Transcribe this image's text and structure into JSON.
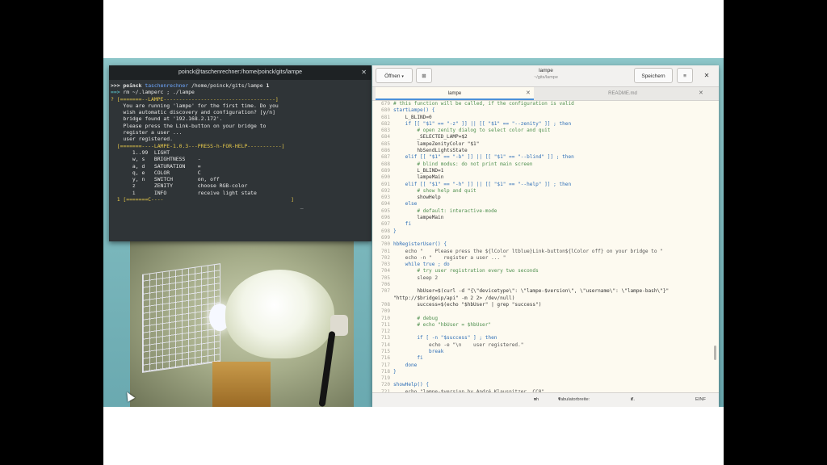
{
  "terminal": {
    "title": "poinck@taschenrechner:/home/poinck/gits/lampe",
    "prompt_user": "poinck",
    "prompt_host": "taschenrechner",
    "prompt_path": "/home/poinck/gits/lampe",
    "prompt_num": "1",
    "cmd": "rm ~/.lamperc ; ./lampe",
    "lines": [
      "? [=======--LAMPE------------------------------------]",
      "    You are running 'lampe' for the first time. Do you",
      "    wish automatic discovery and configuration? [y/n]",
      "    bridge found at '192.168.2.172'.",
      "    Please press the Link-button on your bridge to",
      "    register a user ...",
      "    user registered.",
      "  [=======----LAMPE-1.0.3---PRESS-h-FOR-HELP-----------]",
      "       1..99  LIGHT",
      "       w, s   BRIGHTNESS    -",
      "       a, d   SATURATION    =",
      "       q, e   COLOR         C",
      "       y, n   SWITCH        on, off",
      "       z      ZENITY        choose RGB-color",
      "       i      INFO          receive light state",
      "  1 [=======C----                                         ]",
      "                                                             _"
    ]
  },
  "editor": {
    "open_label": "Öffnen",
    "title": "lampe",
    "subtitle": "~/gits/lampe",
    "save_label": "Speichern",
    "tabs": [
      {
        "label": "lampe"
      },
      {
        "label": "README.md"
      }
    ],
    "code_lines": [
      {
        "n": "679",
        "t": "# this function will be called, if the configuration is valid"
      },
      {
        "n": "680",
        "t": "startLampe() {"
      },
      {
        "n": "681",
        "t": "    L_BLIND=0"
      },
      {
        "n": "682",
        "t": "    if [[ \"$1\" == \"-z\" ]] || [[ \"$1\" == \"--zenity\" ]] ; then"
      },
      {
        "n": "683",
        "t": "        # open zenity dialog to select color and quit"
      },
      {
        "n": "684",
        "t": "        _SELECTED_LAMP=$2"
      },
      {
        "n": "685",
        "t": "        lampeZenityColor \"$1\""
      },
      {
        "n": "686",
        "t": "        hbSendLightsState"
      },
      {
        "n": "687",
        "t": "    elif [[ \"$1\" == \"-b\" ]] || [[ \"$1\" == \"--blind\" ]] ; then"
      },
      {
        "n": "688",
        "t": "        # blind modus: do not print main screen"
      },
      {
        "n": "689",
        "t": "        L_BLIND=1"
      },
      {
        "n": "690",
        "t": "        lampeMain"
      },
      {
        "n": "691",
        "t": "    elif [[ \"$1\" == \"-h\" ]] || [[ \"$1\" == \"--help\" ]] ; then"
      },
      {
        "n": "692",
        "t": "        # show help and quit"
      },
      {
        "n": "693",
        "t": "        showHelp"
      },
      {
        "n": "694",
        "t": "    else"
      },
      {
        "n": "695",
        "t": "        # default: interactive-mode"
      },
      {
        "n": "696",
        "t": "        lampeMain"
      },
      {
        "n": "697",
        "t": "    fi"
      },
      {
        "n": "698",
        "t": "}"
      },
      {
        "n": "699",
        "t": ""
      },
      {
        "n": "700",
        "t": "hbRegisterUser() {"
      },
      {
        "n": "701",
        "t": "    echo \"    Please press the ${lColor ltblue}Link-button${lColor off} on your bridge to \""
      },
      {
        "n": "702",
        "t": "    echo -n \"    register a user ... \""
      },
      {
        "n": "703",
        "t": "    while true ; do"
      },
      {
        "n": "704",
        "t": "        # try user registration every two seconds"
      },
      {
        "n": "705",
        "t": "        sleep 2"
      },
      {
        "n": "706",
        "t": ""
      },
      {
        "n": "707",
        "t": "        hbUser=$(curl -d \"{\\\"devicetype\\\": \\\"lampe-$version\\\", \\\"username\\\": \\\"lampe-bash\\\"}\""
      },
      {
        "n": "",
        "t": "\"http://$bridgeip/api\" -m 2 2> /dev/null)"
      },
      {
        "n": "708",
        "t": "        success=$(echo \"$hbUser\" | grep \"success\")"
      },
      {
        "n": "709",
        "t": ""
      },
      {
        "n": "710",
        "t": "        # debug"
      },
      {
        "n": "711",
        "t": "        # echo \"hbUser = $hbUser\""
      },
      {
        "n": "712",
        "t": ""
      },
      {
        "n": "713",
        "t": "        if [ -n \"$success\" ] ; then"
      },
      {
        "n": "714",
        "t": "            echo -e \"\\n    user registered.\""
      },
      {
        "n": "715",
        "t": "            break"
      },
      {
        "n": "716",
        "t": "        fi"
      },
      {
        "n": "717",
        "t": "    done"
      },
      {
        "n": "718",
        "t": "}"
      },
      {
        "n": "719",
        "t": ""
      },
      {
        "n": "720",
        "t": "showHelp() {"
      },
      {
        "n": "721",
        "t": "    echo \"lampe-$version by André Klausnitzer, CC0\""
      }
    ],
    "status": {
      "language": "sh",
      "tab_width": "Tabulatorbreite: 4",
      "position": "Z. 22, Sp. 13",
      "mode": "EINF"
    }
  }
}
